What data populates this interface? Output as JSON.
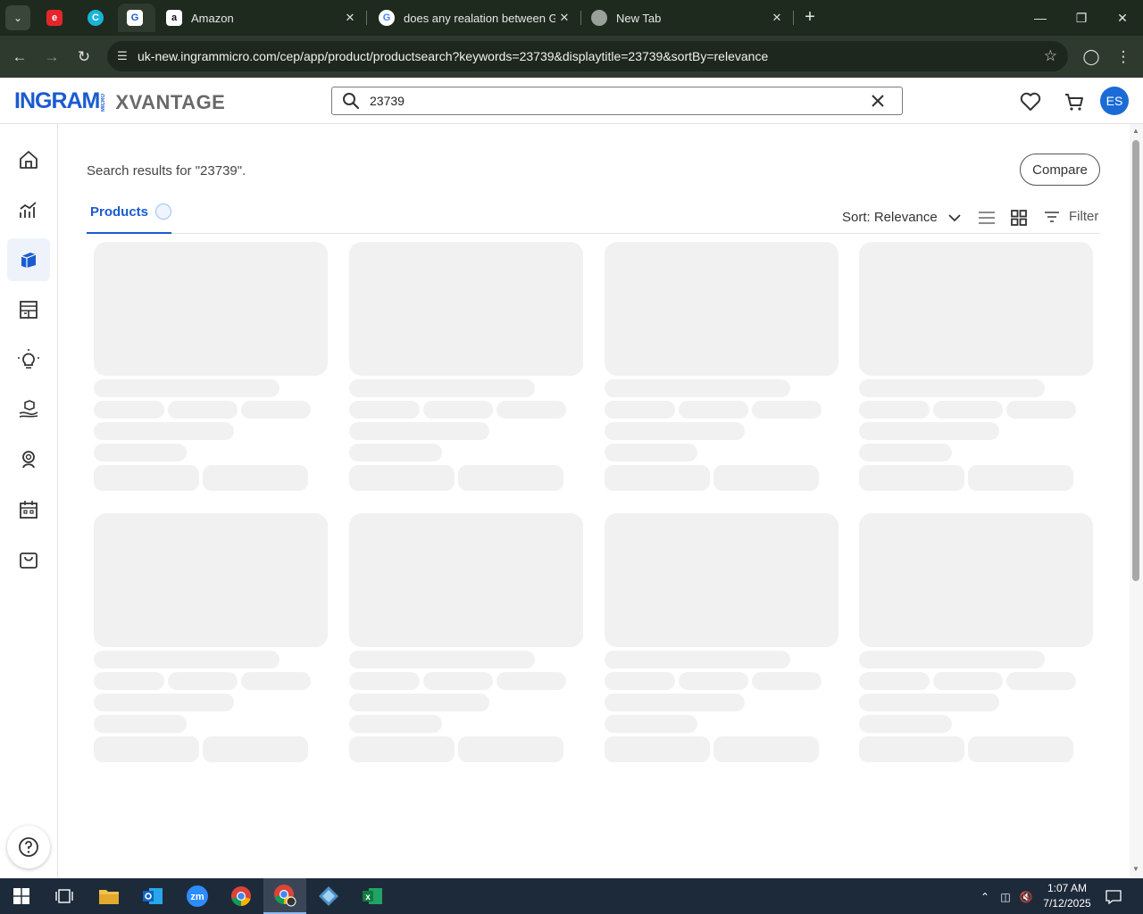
{
  "browser": {
    "tabs": [
      {
        "title": "",
        "favicon": "e-icon",
        "fav_text": "e"
      },
      {
        "title": "",
        "favicon": "c-icon",
        "fav_text": "C"
      },
      {
        "title": "",
        "favicon": "ingram-icon",
        "fav_text": "G",
        "active": true
      },
      {
        "title": "Amazon",
        "favicon": "amazon-icon",
        "fav_text": "a"
      },
      {
        "title": "does any realation between Gr",
        "favicon": "google-icon",
        "fav_text": "G"
      },
      {
        "title": "New Tab",
        "favicon": "chrome-icon",
        "fav_text": ""
      }
    ],
    "url": "uk-new.ingrammicro.com/cep/app/product/productsearch?keywords=23739&displaytitle=23739&sortBy=relevance"
  },
  "header": {
    "logo_ingram": "INGRAM",
    "logo_micro": "MICRO",
    "logo_xvantage": "XVANTAGE",
    "search_value": "23739",
    "avatar_initials": "ES"
  },
  "main": {
    "results_title": "Search results for \"23739\".",
    "compare_label": "Compare",
    "tab_products": "Products",
    "sort_label": "Sort: Relevance",
    "filter_label": "Filter"
  },
  "taskbar": {
    "time": "1:07 AM",
    "date": "7/12/2025"
  },
  "colors": {
    "brand_blue": "#1b5bd1",
    "skeleton": "#f1f1f1",
    "tab_strip": "#1f2a1f",
    "taskbar": "#1d2a3a"
  }
}
